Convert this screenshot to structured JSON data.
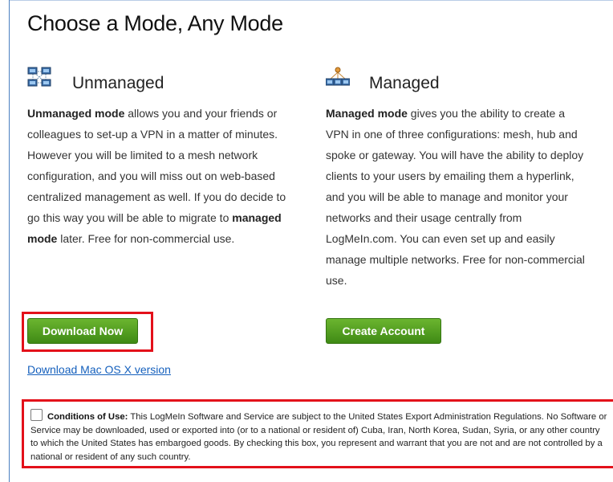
{
  "page": {
    "title": "Choose a Mode, Any Mode"
  },
  "unmanaged": {
    "icon": "mesh-network-icon",
    "title": "Unmanaged",
    "desc_bold_lead": "Unmanaged mode",
    "desc_part1": " allows you and your friends or colleagues to set-up a VPN in a matter of minutes. However you will be limited to a mesh network configuration, and you will miss out on web-based centralized management as well. If you do decide to go this way you will be able to migrate to ",
    "desc_bold_mid": "managed mode",
    "desc_part2": " later. Free for non-commercial use.",
    "button_label": "Download Now",
    "mac_link": "Download Mac OS X version"
  },
  "managed": {
    "icon": "managed-network-icon",
    "title": "Managed",
    "desc_bold_lead": "Managed mode",
    "desc_part1": " gives you the ability to create a VPN in one of three configurations: mesh, hub and spoke or gateway. You will have the ability to deploy clients to your users by emailing them a hyperlink, and you will be able to manage and monitor your networks and their usage centrally from LogMeIn.com. You can even set up and easily manage multiple networks. Free for non-commercial use.",
    "button_label": "Create Account"
  },
  "conditions": {
    "label": "Conditions of Use:",
    "text": " This LogMeIn Software and Service are subject to the United States Export Administration Regulations. No Software or Service may be downloaded, used or exported into (or to a national or resident of) Cuba, Iran, North Korea, Sudan, Syria, or any other country to which the United States has embargoed goods. By checking this box, you represent and warrant that you are not and are not controlled by a national or resident of any such country.",
    "checked": false
  },
  "colors": {
    "button_green": "#4f9a1f",
    "highlight_red": "#e3101a",
    "link_blue": "#1560bd"
  }
}
